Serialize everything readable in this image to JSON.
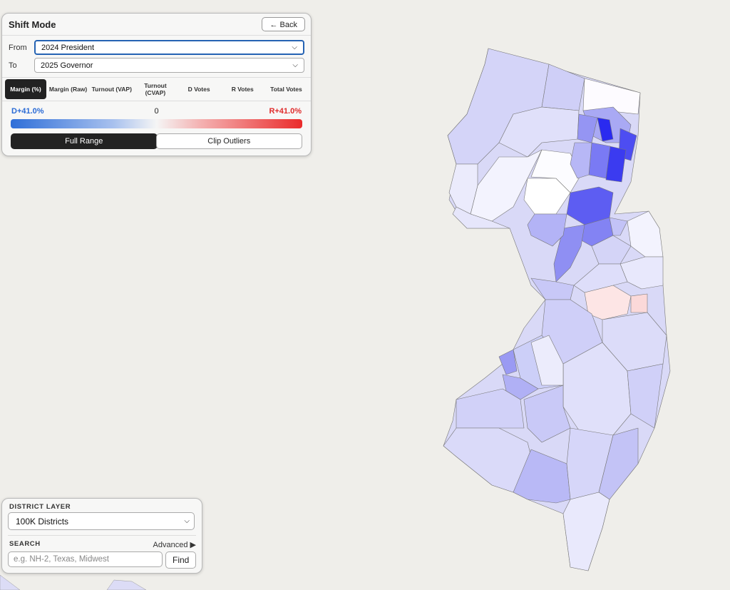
{
  "shift_panel": {
    "title": "Shift Mode",
    "back_label": "← Back",
    "from_label": "From",
    "from_value": "2024 President",
    "to_label": "To",
    "to_value": "2025 Governor",
    "tabs": [
      {
        "label": "Margin (%)",
        "active": true
      },
      {
        "label": "Margin (Raw)",
        "active": false
      },
      {
        "label": "Turnout (VAP)",
        "active": false
      },
      {
        "label": "Turnout (CVAP)",
        "active": false
      },
      {
        "label": "D Votes",
        "active": false
      },
      {
        "label": "R Votes",
        "active": false
      },
      {
        "label": "Total Votes",
        "active": false
      }
    ],
    "legend": {
      "left": "D+41.0%",
      "middle": "0",
      "right": "R+41.0%"
    },
    "range_buttons": {
      "full": "Full Range",
      "clip": "Clip Outliers"
    },
    "colors": {
      "dem": "#2f6fd8",
      "rep": "#ea2b2b",
      "neutral": "#f5f5f5"
    }
  },
  "district_panel": {
    "layer_title": "DISTRICT LAYER",
    "layer_value": "100K Districts",
    "search_title": "SEARCH",
    "advanced_label": "Advanced ▶",
    "search_placeholder": "e.g. NH-2, Texas, Midwest",
    "find_label": "Find"
  },
  "map": {
    "state": "New Jersey",
    "background": "#efeeea"
  }
}
